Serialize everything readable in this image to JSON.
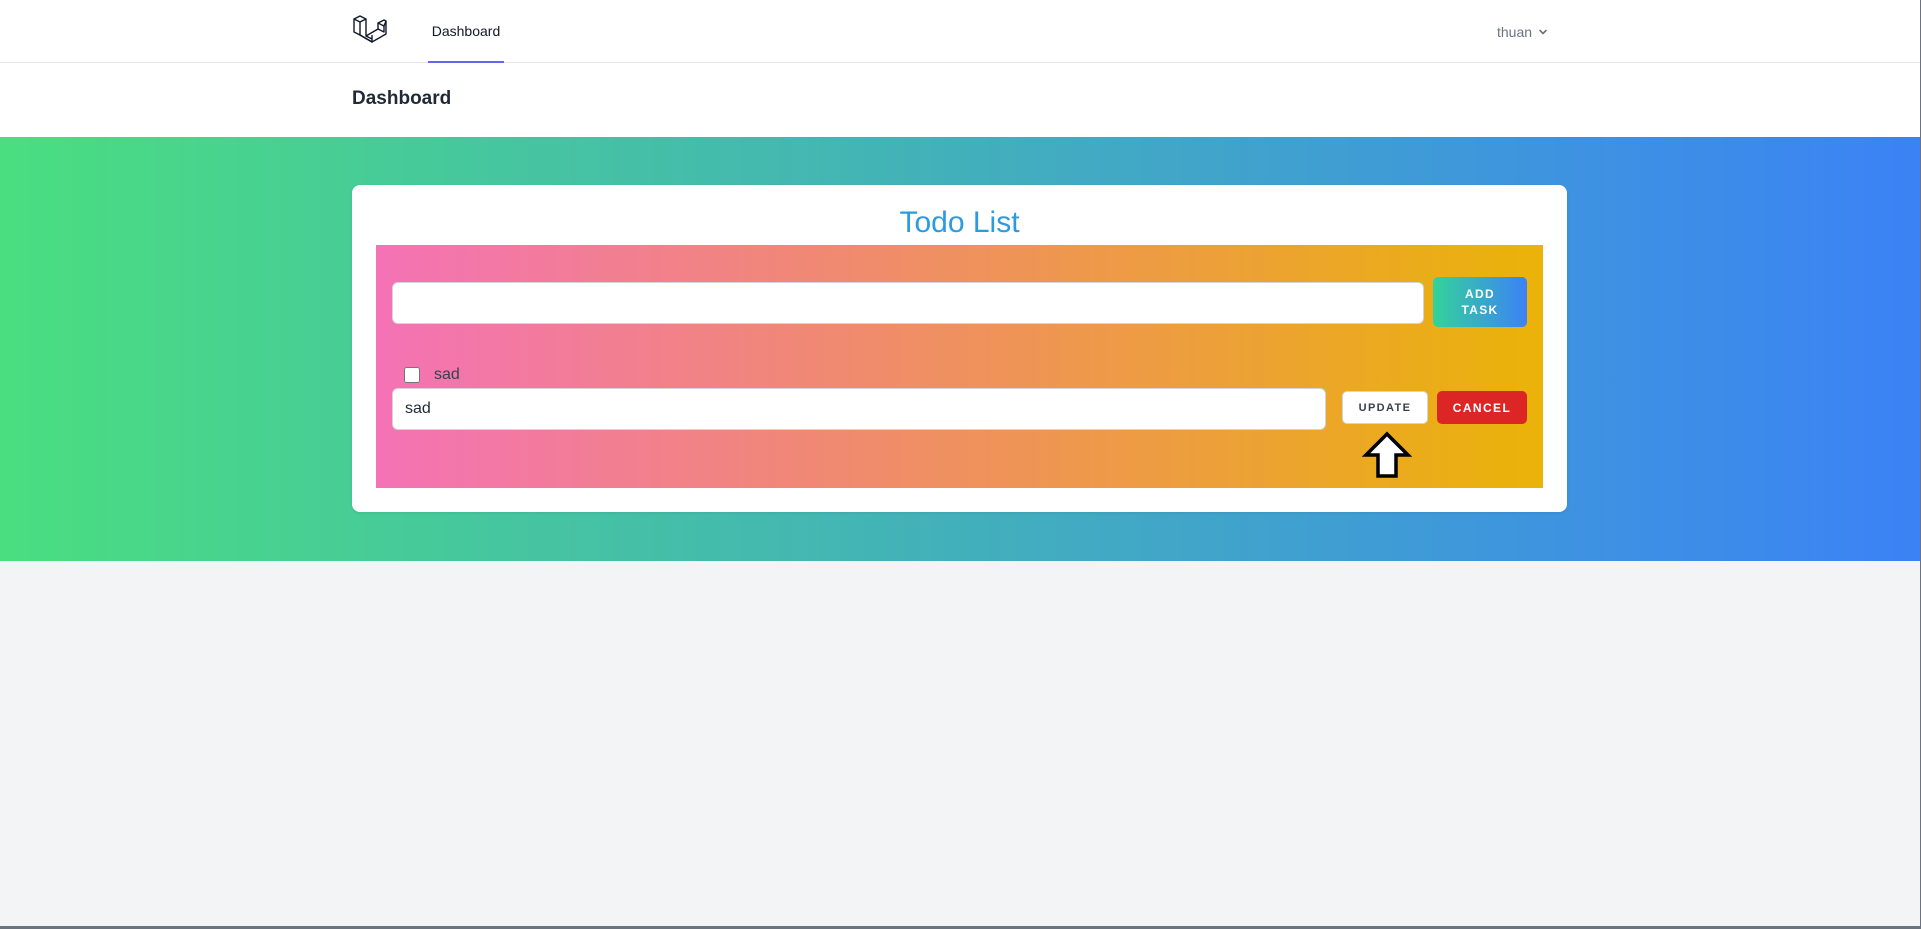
{
  "navbar": {
    "logo_icon": "laravel-logo-icon",
    "links": [
      {
        "label": "Dashboard",
        "active": true
      }
    ],
    "user": {
      "name": "thuan",
      "icon": "chevron-down-icon"
    }
  },
  "header": {
    "title": "Dashboard"
  },
  "todo": {
    "title": "Todo List",
    "new_task": {
      "value": "",
      "placeholder": ""
    },
    "add_button_label": "ADD TASK",
    "tasks": [
      {
        "text": "sad",
        "checked": false,
        "edit_value": "sad"
      }
    ],
    "update_button_label": "UPDATE",
    "cancel_button_label": "CANCEL",
    "annotation_icon": "arrow-up-icon"
  },
  "colors": {
    "hero_gradient": [
      "#4ade80",
      "#3b82f6"
    ],
    "panel_gradient": [
      "#f472b6",
      "#eab308"
    ],
    "title_color": "#2a9be0",
    "cancel_color": "#dc2626",
    "nav_active_underline": "#6366f1"
  }
}
